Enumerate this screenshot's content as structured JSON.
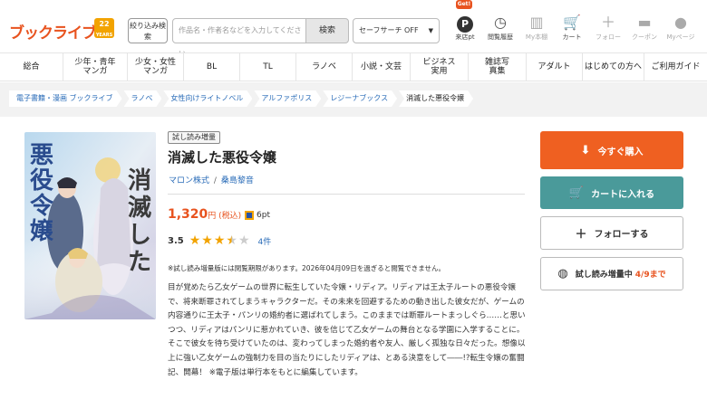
{
  "header": {
    "logo_text": "ブックライブ",
    "logo_badge": "22 YEARS",
    "narrow_btn": "絞り込み検索",
    "search_placeholder": "作品名・作者名などを入力してください",
    "search_btn": "検索",
    "safe_search": "セーフサーチ OFF",
    "get_badge": "Get!",
    "icons": [
      {
        "label": "来店pt",
        "icon": "point-icon"
      },
      {
        "label": "閲覧履歴",
        "icon": "history-icon"
      },
      {
        "label": "My本棚",
        "icon": "bookshelf-icon"
      },
      {
        "label": "カート",
        "icon": "cart-icon"
      },
      {
        "label": "フォロー",
        "icon": "plus-icon"
      },
      {
        "label": "クーポン",
        "icon": "coupon-icon"
      },
      {
        "label": "Myページ",
        "icon": "user-icon"
      }
    ]
  },
  "nav": [
    "総合",
    "少年・青年マンガ",
    "少女・女性マンガ",
    "BL",
    "TL",
    "ラノベ",
    "小説・文芸",
    "ビジネス実用",
    "雑誌写真集",
    "アダルト",
    "はじめての方へ",
    "ご利用ガイド"
  ],
  "breadcrumb": [
    "電子書籍・漫画 ブックライブ",
    "ラノベ",
    "女性向けライトノベル",
    "アルファポリス",
    "レジーナブックス",
    "消滅した悪役令嬢"
  ],
  "book": {
    "trial_tag": "試し読み増量",
    "title": "消滅した悪役令嬢",
    "author1": "マロン株式",
    "author_sep": "/",
    "author2": "桑島黎音",
    "price": "1,320",
    "price_suffix": "円 (税込)",
    "points": "6pt",
    "rating_score": "3.5",
    "rating_value": 3.5,
    "review_count": "4件",
    "notice": "※試し読み増量版には閲覧期限があります。2026年04月09日を過ぎると閲覧できません。",
    "description": "目が覚めたら乙女ゲームの世界に転生していた令嬢・リディア。リディアは王太子ルートの悪役令嬢で、将来断罪されてしまうキャラクターだ。その未来を回避するための動き出した彼女だが、ゲームの内容通りに王太子・パンリの婚約者に選ばれてしまう。このままでは断罪ルートまっしぐら……と思いつつ、リディアはパンリに惹かれていき、彼を信じて乙女ゲームの舞台となる学園に入学することに。そこで彼女を待ち受けていたのは、変わってしまった婚約者や友人、厳しく孤独な日々だった。想像以上に強い乙女ゲームの強制力を目の当たりにしたリディアは、とある決意をして――!?転生令嬢の奮闘記、開幕！ ※電子版は単行本をもとに編集しています。",
    "cover_title": "消滅した悪役令嬢"
  },
  "actions": {
    "buy": "今すぐ購入",
    "cart": "カートに入れる",
    "follow": "フォローする",
    "trial": "試し読み増量中",
    "trial_until": "4/9まで"
  },
  "colors": {
    "brand": "#e8531f",
    "buy": "#ef6021",
    "cart": "#4a9a9a",
    "link": "#2a6cb8",
    "star": "#f2a300"
  }
}
